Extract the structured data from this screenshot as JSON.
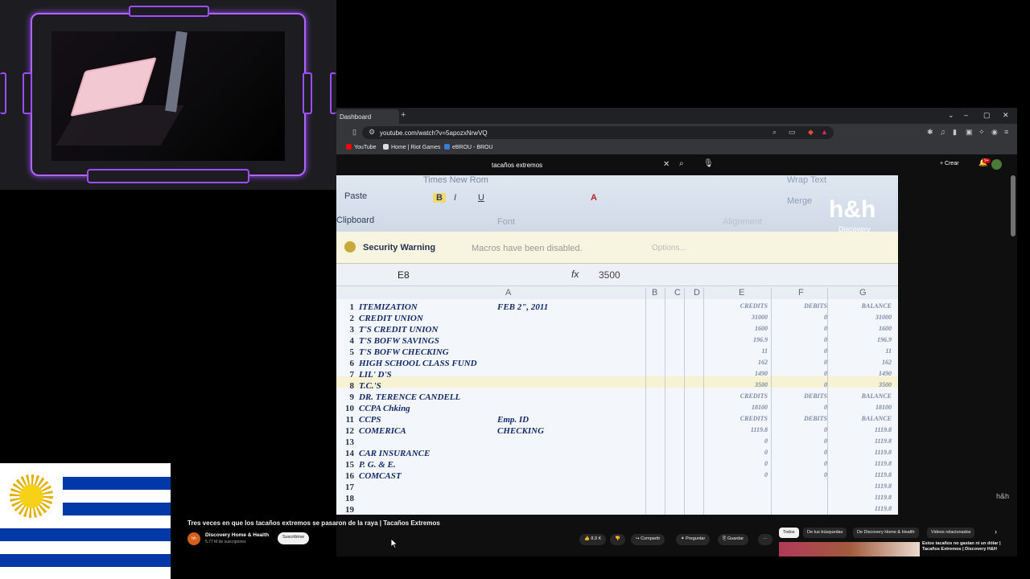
{
  "browser": {
    "tab_title": "Dashboard",
    "new_tab": "+",
    "url": "youtube.com/watch?v=5apozxNrwVQ",
    "bookmarks": [
      "YouTube",
      "Home | Riot Games",
      "eBROU - BROU"
    ],
    "window_controls": {
      "dropdown": "⌄",
      "minimize": "–",
      "maximize": "▢",
      "close": "✕"
    }
  },
  "youtube": {
    "search_query": "tacaños extremos",
    "create_label": "Crear",
    "notification_count": "9+",
    "video": {
      "title": "Tres veces en que los tacaños extremos se pasaron de la raya | Tacaños Extremos",
      "channel": "Discovery Home & Health",
      "channel_initials": "hh",
      "subscribers": "5,77 M de suscriptores",
      "subscribe_label": "Suscribirse",
      "likes": "8,9 K",
      "share_label": "Compartir",
      "ask_label": "Preguntar",
      "save_label": "Guardar",
      "more_label": "···"
    },
    "chips": [
      "Todos",
      "De tus búsquedas",
      "De Discovery Home & Health",
      "Videos relacionados"
    ],
    "chip_next": "›",
    "recommendation": {
      "title": "Estos tacaños no gastan ni un dólar | Tacaños Extremos | Discovery H&H"
    },
    "watermark": "h&h"
  },
  "excel_frame": {
    "ribbon": {
      "font_name": "Times New Rom",
      "paste": "Paste",
      "clipboard": "Clipboard",
      "font_group": "Font",
      "alignment": "Alignment",
      "merge": "Merge",
      "wrap": "Wrap Text"
    },
    "security_warning": {
      "title": "Security Warning",
      "message": "Macros have been disabled.",
      "options": "Options..."
    },
    "formula_bar": {
      "cell": "E8",
      "fx": "fx",
      "value": "3500"
    },
    "columns": [
      "A",
      "B",
      "C",
      "D",
      "E",
      "F",
      "G"
    ],
    "rows": [
      {
        "n": "1",
        "a": "ITEMIZATION",
        "b": "FEB 2\", 2011",
        "e": "CREDITS",
        "f": "DEBITS",
        "g": "BALANCE"
      },
      {
        "n": "2",
        "a": "CREDIT UNION",
        "b": "",
        "e": "31000",
        "f": "0",
        "g": "31000"
      },
      {
        "n": "3",
        "a": "T'S CREDIT UNION",
        "b": "",
        "e": "1600",
        "f": "0",
        "g": "1600"
      },
      {
        "n": "4",
        "a": "T'S BOFW SAVINGS",
        "b": "",
        "e": "196.9",
        "f": "0",
        "g": "196.9"
      },
      {
        "n": "5",
        "a": "T'S BOFW CHECKING",
        "b": "",
        "e": "11",
        "f": "0",
        "g": "11"
      },
      {
        "n": "6",
        "a": "HIGH SCHOOL CLASS FUND",
        "b": "",
        "e": "162",
        "f": "0",
        "g": "162"
      },
      {
        "n": "7",
        "a": "LIL' D'S",
        "b": "",
        "e": "1490",
        "f": "0",
        "g": "1490"
      },
      {
        "n": "8",
        "a": "T.C.'S",
        "b": "",
        "e": "3500",
        "f": "0",
        "g": "3500"
      },
      {
        "n": "9",
        "a": "DR. TERENCE CANDELL",
        "b": "",
        "e": "CREDITS",
        "f": "DEBITS",
        "g": "BALANCE"
      },
      {
        "n": "10",
        "a": "CCPA  Chking",
        "b": "",
        "e": "18100",
        "f": "0",
        "g": "18100"
      },
      {
        "n": "11",
        "a": "CCPS",
        "b": "Emp. ID",
        "e": "CREDITS",
        "f": "DEBITS",
        "g": "BALANCE"
      },
      {
        "n": "12",
        "a": "COMERICA",
        "b": "CHECKING",
        "e": "1119.8",
        "f": "0",
        "g": "1119.8"
      },
      {
        "n": "13",
        "a": "",
        "b": "",
        "e": "0",
        "f": "0",
        "g": "1119.8"
      },
      {
        "n": "14",
        "a": "CAR INSURANCE",
        "b": "",
        "e": "0",
        "f": "0",
        "g": "1119.8"
      },
      {
        "n": "15",
        "a": "P. G. & E.",
        "b": "",
        "e": "0",
        "f": "0",
        "g": "1119.8"
      },
      {
        "n": "16",
        "a": "COMCAST",
        "b": "",
        "e": "0",
        "f": "0",
        "g": "1119.8"
      },
      {
        "n": "17",
        "a": "",
        "b": "",
        "e": "",
        "f": "",
        "g": "1119.8"
      },
      {
        "n": "18",
        "a": "",
        "b": "",
        "e": "",
        "f": "",
        "g": "1119.8"
      },
      {
        "n": "19",
        "a": "",
        "b": "",
        "e": "",
        "f": "",
        "g": "1119.8"
      }
    ],
    "logo": "h&h",
    "logo_sub": "Discovery"
  },
  "colors": {
    "frame_accent": "#b065ff",
    "flag_blue": "#0038a8",
    "sun_yellow": "#f7d117",
    "yt_bg": "#0f0f0f"
  }
}
